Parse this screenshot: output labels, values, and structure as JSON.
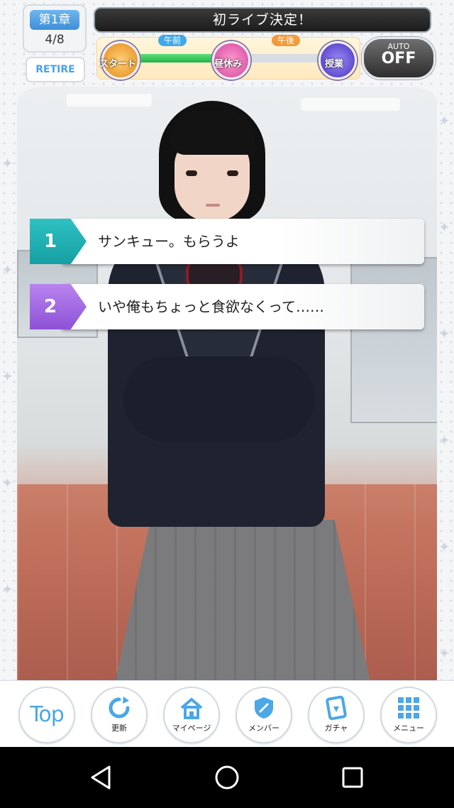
{
  "hud": {
    "chapter": "第1章",
    "progress": "4/8",
    "retire_label": "RETIRE",
    "title": "初ライブ決定！",
    "timeline": {
      "am_label": "午前",
      "pm_label": "午後",
      "nodes": [
        "スタート",
        "昼休み",
        "授業"
      ],
      "progress_fraction": 0.5
    },
    "auto": {
      "label": "AUTO",
      "value": "OFF"
    }
  },
  "choices": [
    {
      "number": "1",
      "text": "サンキュー。もらうよ",
      "accent": "#1fb0b3"
    },
    {
      "number": "2",
      "text": "いや俺もちょっと食欲なくって……",
      "accent": "#a56ae4"
    }
  ],
  "menu": {
    "top": "Top",
    "items": [
      {
        "label": "更新",
        "icon": "refresh-icon"
      },
      {
        "label": "マイページ",
        "icon": "home-icon"
      },
      {
        "label": "メンバー",
        "icon": "shield-icon"
      },
      {
        "label": "ガチャ",
        "icon": "card-icon"
      },
      {
        "label": "メニュー",
        "icon": "grid-icon"
      }
    ]
  },
  "colors": {
    "accent_blue": "#4aa7e8",
    "title_bar": "#1c1c1c"
  }
}
